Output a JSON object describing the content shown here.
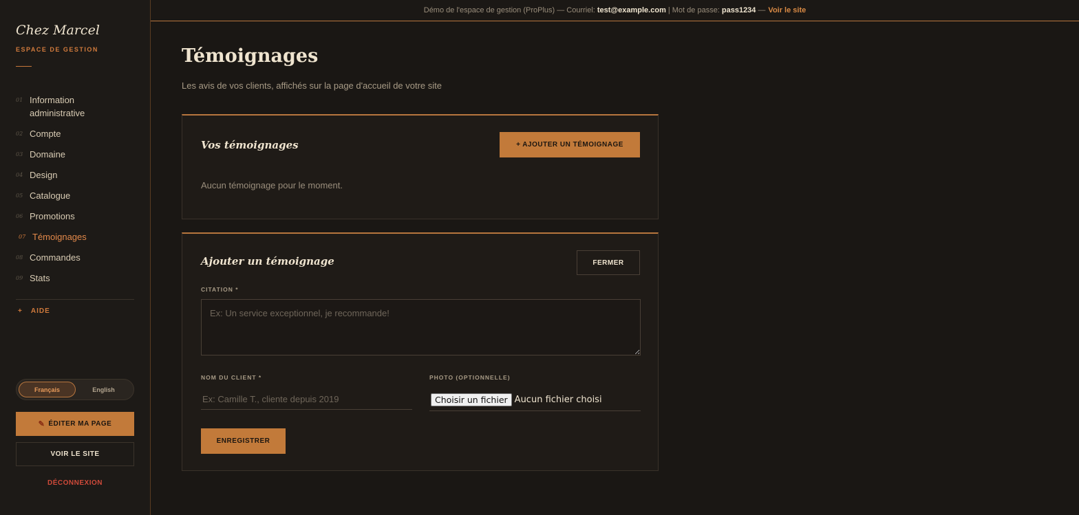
{
  "banner": {
    "prefix": "Démo de l'espace de gestion (ProPlus) — Courriel:",
    "email": "test@example.com",
    "sep": "| Mot de passe:",
    "password": "pass1234",
    "dash": "—",
    "link": "Voir le site"
  },
  "sidebar": {
    "brand": "Chez Marcel",
    "subtitle": "ESPACE DE GESTION",
    "items": [
      {
        "num": "01",
        "label": "Information administrative"
      },
      {
        "num": "02",
        "label": "Compte"
      },
      {
        "num": "03",
        "label": "Domaine"
      },
      {
        "num": "04",
        "label": "Design"
      },
      {
        "num": "05",
        "label": "Catalogue"
      },
      {
        "num": "06",
        "label": "Promotions"
      },
      {
        "num": "07",
        "label": "Témoignages"
      },
      {
        "num": "08",
        "label": "Commandes"
      },
      {
        "num": "09",
        "label": "Stats"
      }
    ],
    "help": "AIDE",
    "help_plus": "+",
    "lang_fr": "Français",
    "lang_en": "English",
    "edit_button": "ÉDITER MA PAGE",
    "view_button": "VOIR LE SITE",
    "logout": "DÉCONNEXION"
  },
  "main": {
    "title": "Témoignages",
    "subtitle": "Les avis de vos clients, affichés sur la page d'accueil de votre site",
    "list_card": {
      "title": "Vos témoignages",
      "add_button": "+ AJOUTER UN TÉMOIGNAGE",
      "empty": "Aucun témoignage pour le moment."
    },
    "form_card": {
      "title": "Ajouter un témoignage",
      "close_button": "FERMER",
      "citation_label": "CITATION *",
      "citation_placeholder": "Ex: Un service exceptionnel, je recommande!",
      "client_label": "NOM DU CLIENT *",
      "client_placeholder": "Ex: Camille T., cliente depuis 2019",
      "photo_label": "PHOTO (OPTIONNELLE)",
      "file_button": "Choisir un fichier",
      "file_status": "Aucun fichier choisi",
      "save_button": "ENREGISTRER"
    }
  },
  "colors": {
    "accent": "#c27a3a",
    "background": "#1a1714",
    "danger": "#d04a3a"
  }
}
